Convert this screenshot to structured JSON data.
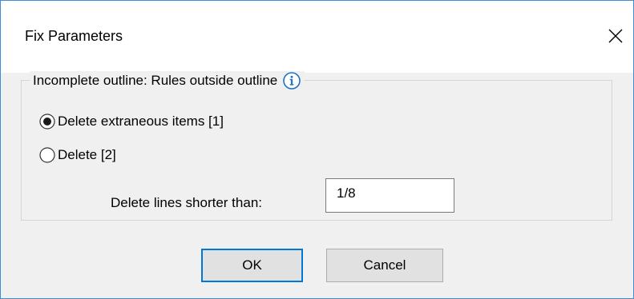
{
  "dialog": {
    "title": "Fix Parameters",
    "close_icon": "close-icon"
  },
  "group": {
    "title": "Incomplete outline: Rules outside outline",
    "info_icon": "info-icon"
  },
  "options": [
    {
      "label": "Delete extraneous items [1]",
      "selected": true
    },
    {
      "label": "Delete [2]",
      "selected": false
    }
  ],
  "field": {
    "label": "Delete lines shorter than:",
    "value": "1/8"
  },
  "buttons": {
    "ok_label": "OK",
    "cancel_label": "Cancel"
  },
  "colors": {
    "accent": "#0078d7",
    "info_icon": "#1a73c9",
    "dialog_background": "#f0f0f0"
  }
}
